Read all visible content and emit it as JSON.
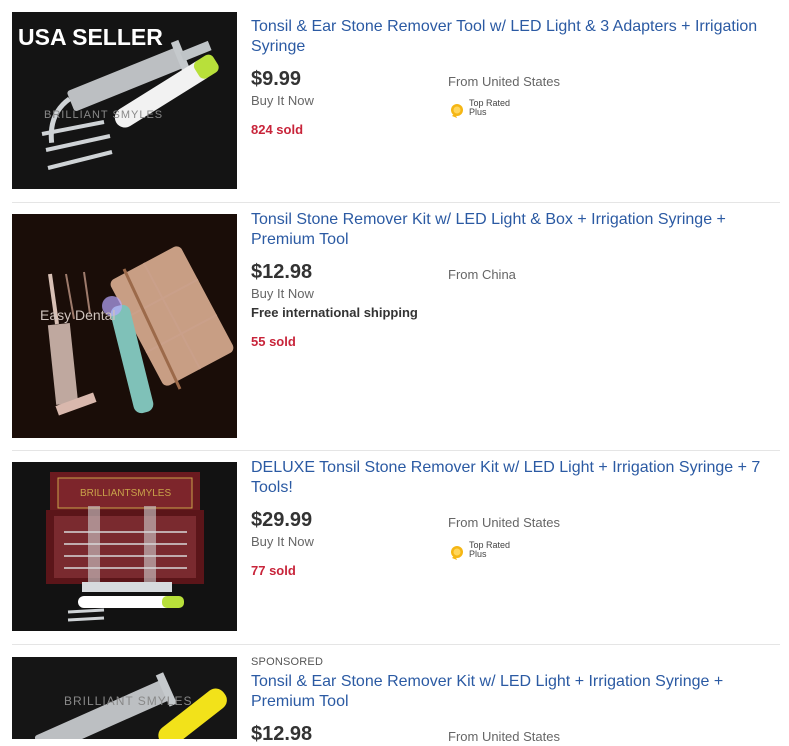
{
  "listings": [
    {
      "image_overlay": "USA SELLER",
      "image_watermark": "BRILLIANT SMYLES",
      "title": "Tonsil & Ear Stone Remover Tool w/ LED Light & 3 Adapters + Irrigation Syringe",
      "price": "$9.99",
      "format": "Buy It Now",
      "sold": "824 sold",
      "location": "From United States",
      "badge": {
        "line1": "Top Rated",
        "line2": "Plus",
        "icon": "medal-icon"
      }
    },
    {
      "image_watermark": "Easy Dental",
      "title": "Tonsil Stone Remover Kit w/ LED Light & Box + Irrigation Syringe + Premium Tool",
      "price": "$12.98",
      "format": "Buy It Now",
      "shipping": "Free international shipping",
      "sold": "55 sold",
      "location": "From China"
    },
    {
      "image_watermark": "BRILLIANTSMYLES",
      "title": "DELUXE Tonsil Stone Remover Kit w/ LED Light + Irrigation Syringe + 7 Tools!",
      "price": "$29.99",
      "format": "Buy It Now",
      "sold": "77 sold",
      "location": "From United States",
      "badge": {
        "line1": "Top Rated",
        "line2": "Plus",
        "icon": "medal-icon"
      }
    },
    {
      "sponsored": "SPONSORED",
      "image_watermark": "BRILLIANT SMYLES",
      "title": "Tonsil & Ear Stone Remover Kit w/ LED Light + Irrigation Syringe + Premium Tool",
      "price": "$12.98",
      "location": "From United States"
    }
  ],
  "colors": {
    "link": "#2b5aa3",
    "sold": "#c8243a",
    "divider": "#e5e5e5"
  }
}
